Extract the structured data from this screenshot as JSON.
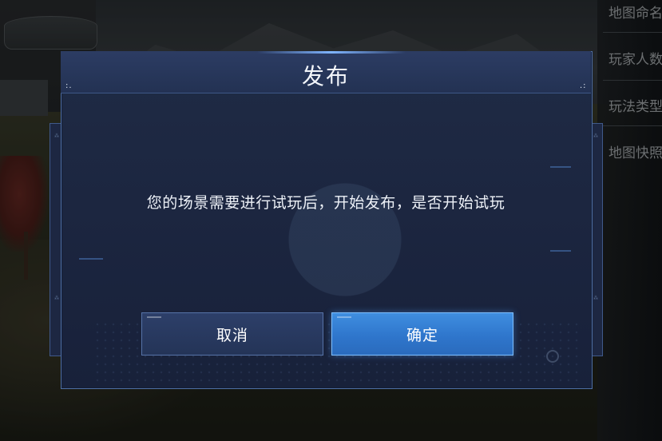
{
  "dialog": {
    "title": "发布",
    "message": "您的场景需要进行试玩后，开始发布，是否开始试玩",
    "corner_left": ":.",
    "corner_right": ".:",
    "cancel_label": "取消",
    "confirm_label": "确定"
  },
  "side_menu": {
    "items": [
      {
        "label": "地图命名"
      },
      {
        "label": "玩家人数"
      },
      {
        "label": "玩法类型"
      },
      {
        "label": "地图快照"
      }
    ]
  },
  "colors": {
    "confirm_button": "#2f76cc",
    "cancel_button": "#2d3f69",
    "panel_background": "#1c2640",
    "panel_border": "#4f6fa3"
  },
  "icons": {
    "search": "search-icon"
  }
}
